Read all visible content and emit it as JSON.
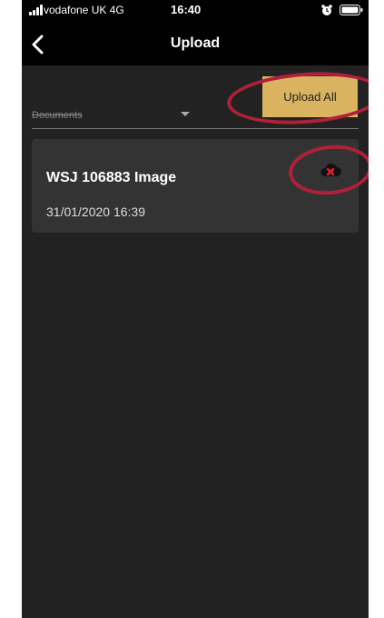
{
  "status_bar": {
    "carrier": "vodafone UK  4G",
    "time": "16:40",
    "icons": [
      "signal-icon",
      "alarm-icon",
      "battery-icon"
    ]
  },
  "nav": {
    "title": "Upload",
    "back_icon": "chevron-left-icon"
  },
  "toolbar": {
    "upload_all_label": "Upload All",
    "upload_all_color": "#d9b35f"
  },
  "filter": {
    "selected": "Documents"
  },
  "uploads": [
    {
      "title": "WSJ 106883 Image",
      "date": "31/01/2020 16:39",
      "status_icon": "cloud-error-icon"
    }
  ],
  "colors": {
    "background": "#222222",
    "card": "#333333",
    "annotation": "#b0203a"
  }
}
